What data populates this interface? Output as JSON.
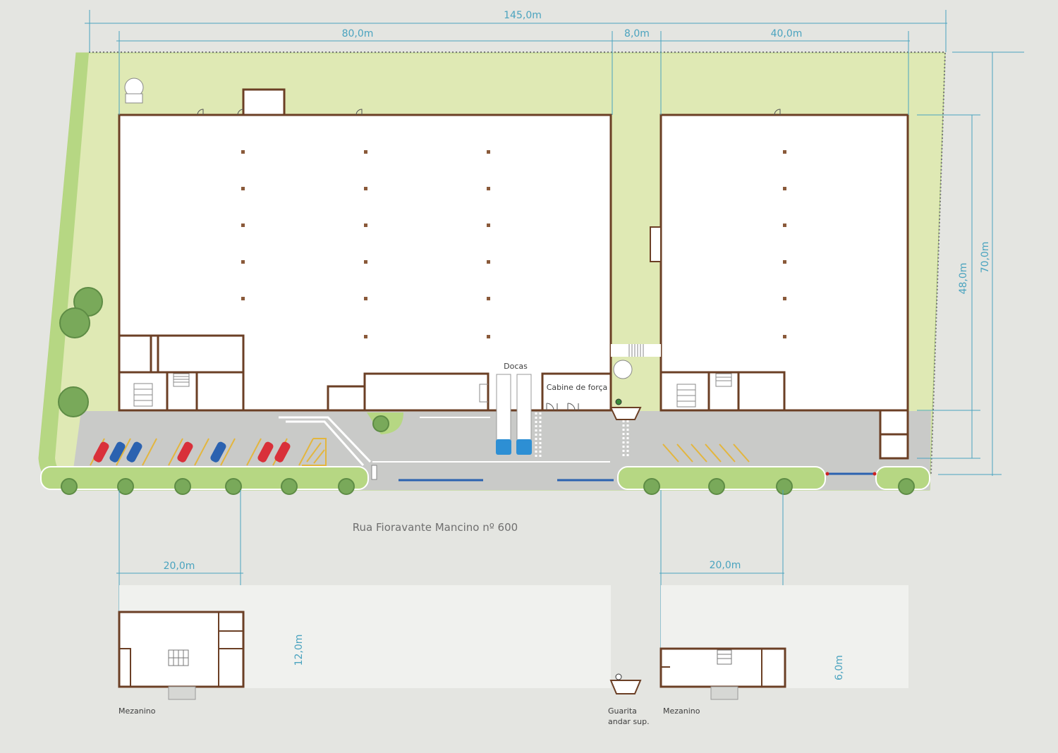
{
  "dimensions": {
    "total_width": "145,0m",
    "building_a_width": "80,0m",
    "gap_width": "8,0m",
    "building_b_width": "40,0m",
    "lot_depth": "70,0m",
    "building_depth": "48,0m",
    "mezzanine_a_width": "20,0m",
    "mezzanine_a_depth": "12,0m",
    "mezzanine_b_width": "20,0m",
    "mezzanine_b_depth": "6,0m"
  },
  "labels": {
    "docks": "Docas",
    "power_cabin": "Cabine de força",
    "street": "Rua Fioravante Mancino nº 600",
    "mezzanine_a": "Mezanino",
    "mezzanine_b": "Mezanino",
    "guardhouse_line1": "Guarita",
    "guardhouse_line2": "andar sup."
  },
  "colors": {
    "background": "#e4e5e1",
    "lawn": "#dfe9b4",
    "lawn_edge": "#b2d37a",
    "pavement": "#c9cac8",
    "wall": "#6b3f25",
    "dimension": "#4aa3bf",
    "car_red": "#d9303a",
    "car_blue": "#2b62b0",
    "truck": "#2d8fd4",
    "parking_stripe": "#e3b63e",
    "tree": "#79a95a"
  },
  "parking": {
    "cars": [
      "red",
      "blue",
      "blue",
      "red",
      "blue",
      "red",
      "red"
    ]
  }
}
